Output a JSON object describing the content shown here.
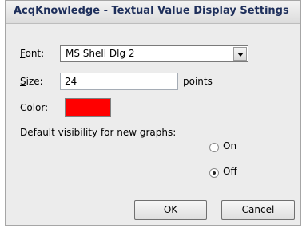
{
  "dialog": {
    "title": "AcqKnowledge - Textual Value Display Settings"
  },
  "font": {
    "label": "Font:",
    "value": "MS Shell Dlg 2"
  },
  "size": {
    "label": "Size:",
    "value": "24",
    "unit": "points"
  },
  "color": {
    "label": "Color:",
    "swatch": "#ff0000"
  },
  "visibility": {
    "label": "Default visibility for new graphs:",
    "options": [
      {
        "label": "On",
        "selected": false
      },
      {
        "label": "Off",
        "selected": true
      }
    ]
  },
  "buttons": {
    "ok": "OK",
    "cancel": "Cancel"
  }
}
